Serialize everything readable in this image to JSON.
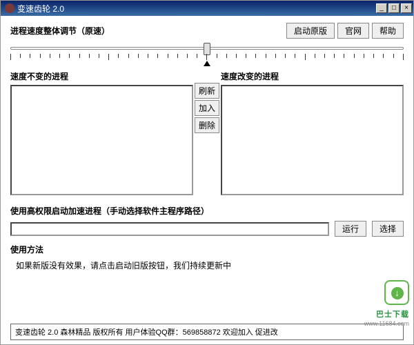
{
  "titlebar": {
    "icon": "gear-icon",
    "title": "变速齿轮 2.0"
  },
  "winbtns": {
    "min": "_",
    "max": "□",
    "close": "×"
  },
  "header": {
    "label": "进程速度整体调节（原速）",
    "launch_orig": "启动原版",
    "official": "官网",
    "help": "帮助"
  },
  "lists": {
    "left_title": "速度不变的进程",
    "right_title": "速度改变的进程",
    "refresh": "刷新",
    "add": "加入",
    "remove": "删除"
  },
  "path": {
    "label": "使用高权限启动加速进程（手动选择软件主程序路径）",
    "value": "",
    "run": "运行",
    "choose": "选择"
  },
  "usage": {
    "title": "使用方法",
    "text": "如果新版没有效果，请点击启动旧版按钮，我们持续更新中"
  },
  "footer": "变速齿轮 2.0 森林精品 版权所有 用户体验QQ群：569858872 欢迎加入 促进改",
  "badge": {
    "line1": "巴士下载",
    "line2": "www.11684.com"
  }
}
